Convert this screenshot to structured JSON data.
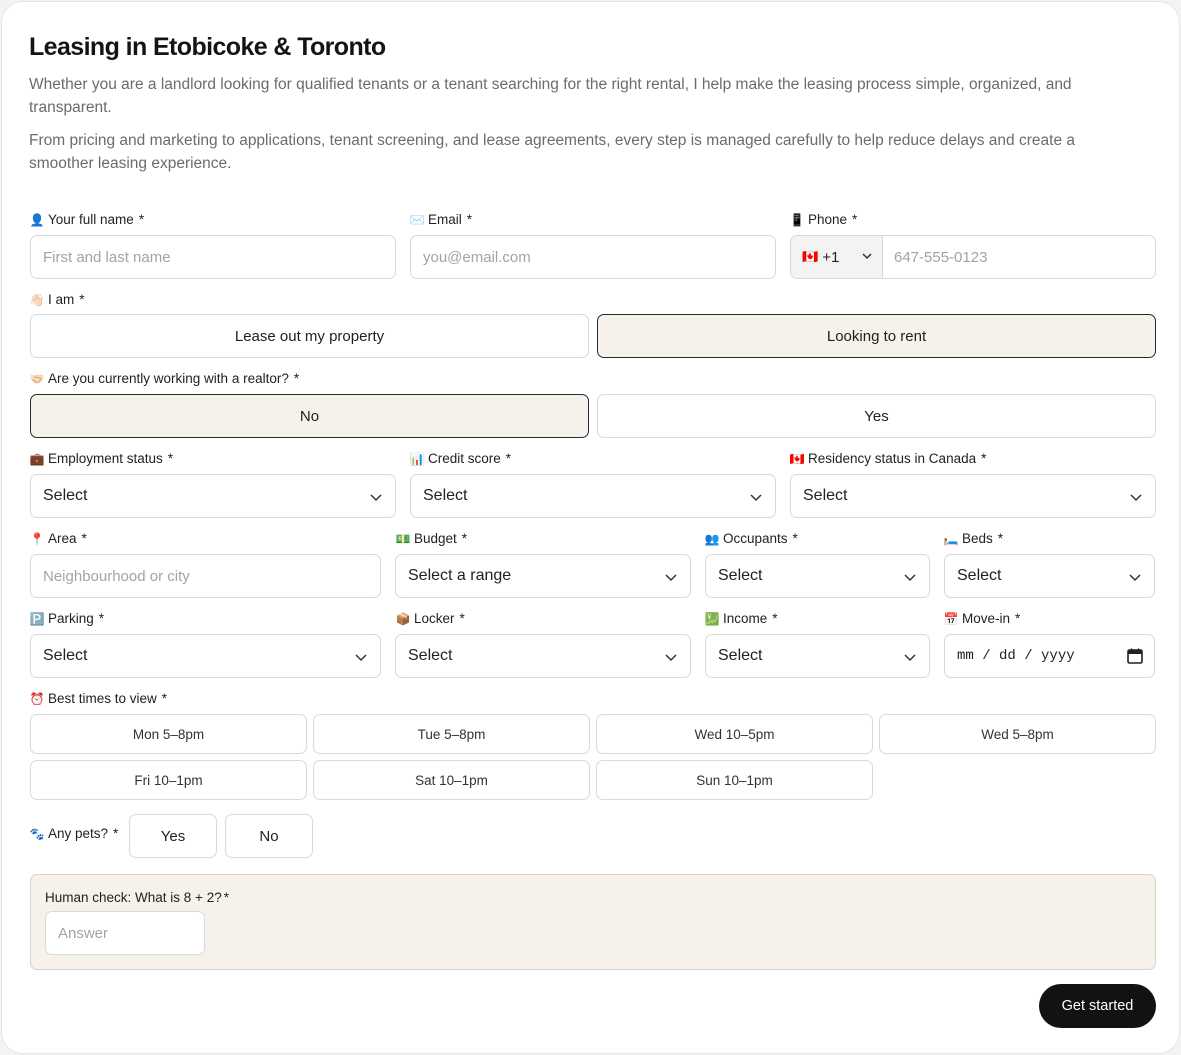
{
  "header": {
    "title": "Leasing in Etobicoke & Toronto",
    "para1": "Whether you are a landlord looking for qualified tenants or a tenant searching for the right rental, I help make the leasing process simple, organized, and transparent.",
    "para2": "From pricing and marketing to applications, tenant screening, and lease agreements, every step is managed carefully to help reduce delays and create a smoother leasing experience."
  },
  "fields": {
    "name": {
      "icon": "👤",
      "label": "Your full name",
      "placeholder": "First and last name"
    },
    "email": {
      "icon": "✉️",
      "label": "Email",
      "placeholder": "you@email.com"
    },
    "phone": {
      "icon": "📱",
      "label": "Phone",
      "country_flag": "🇨🇦",
      "country_code": "+1",
      "placeholder": "647-555-0123"
    },
    "employment": {
      "icon": "💼",
      "label": "Employment status",
      "value": "Select"
    },
    "credit": {
      "icon": "📊",
      "label": "Credit score",
      "value": "Select"
    },
    "residency": {
      "icon": "🇨🇦",
      "label": "Residency status in Canada",
      "value": "Select"
    },
    "area": {
      "icon": "📍",
      "label": "Area",
      "placeholder": "Neighbourhood or city"
    },
    "budget": {
      "icon": "💵",
      "label": "Budget",
      "value": "Select a range"
    },
    "occupants": {
      "icon": "👥",
      "label": "Occupants",
      "value": "Select"
    },
    "beds": {
      "icon": "🛏️",
      "label": "Beds",
      "value": "Select"
    },
    "parking": {
      "icon": "🅿️",
      "label": "Parking",
      "value": "Select"
    },
    "locker": {
      "icon": "📦",
      "label": "Locker",
      "value": "Select"
    },
    "income": {
      "icon": "💹",
      "label": "Income",
      "value": "Select"
    },
    "movein": {
      "icon": "📅",
      "label": "Move-in",
      "value": "mm / dd / yyyy"
    }
  },
  "iam": {
    "icon": "👋🏻",
    "label": "I am",
    "options": [
      "Lease out my property",
      "Looking to rent"
    ],
    "selected": "Looking to rent"
  },
  "realtor": {
    "icon": "🤝🏻",
    "label": "Are you currently working with a realtor?",
    "options": [
      "No",
      "Yes"
    ],
    "selected": "No"
  },
  "viewing": {
    "icon": "⏰",
    "label": "Best times to view",
    "times": [
      "Mon 5–8pm",
      "Tue 5–8pm",
      "Wed 10–5pm",
      "Wed 5–8pm",
      "Fri 10–1pm",
      "Sat 10–1pm",
      "Sun 10–1pm"
    ]
  },
  "pets": {
    "icon": "🐾",
    "label": "Any pets?",
    "options": [
      "Yes",
      "No"
    ]
  },
  "captcha": {
    "question": "Human check: What is 8 + 2?",
    "placeholder": "Answer"
  },
  "required_mark": "*",
  "submit_label": "Get started"
}
